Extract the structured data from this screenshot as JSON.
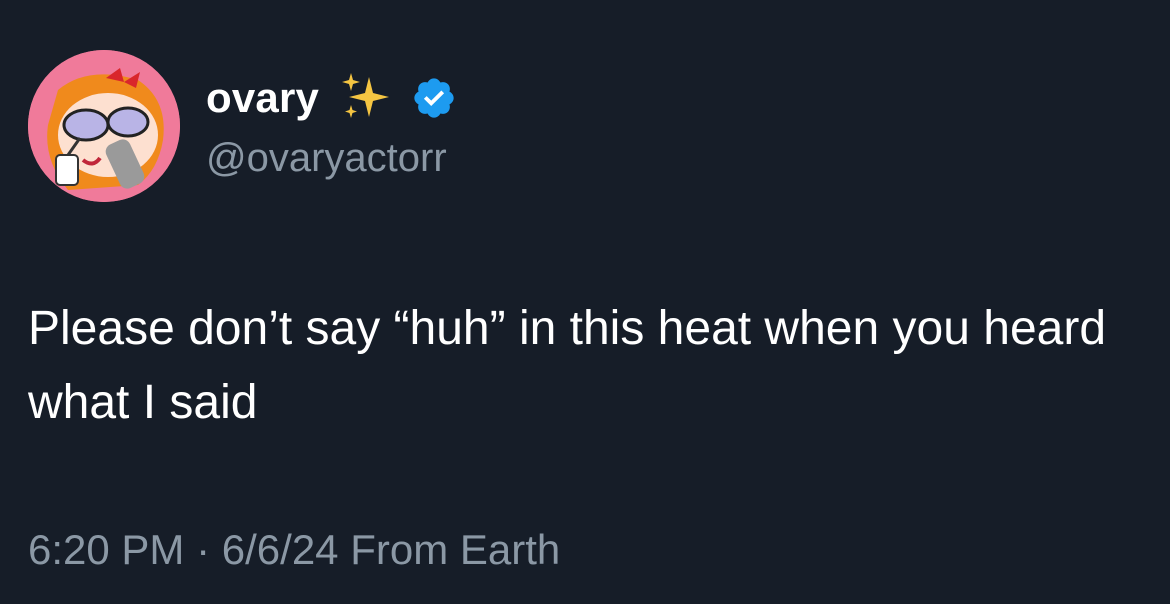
{
  "author": {
    "display_name": "ovary",
    "handle": "@ovaryactorr",
    "verified": true,
    "badge_color": "#1d9bf0",
    "sparkle_color": "#f5c542"
  },
  "tweet": {
    "text": "Please don’t say “huh” in this heat when you heard what I said"
  },
  "meta": {
    "time": "6:20 PM",
    "separator": "·",
    "date": "6/6/24",
    "source": "From Earth",
    "full": "6:20 PM · 6/6/24 From Earth"
  },
  "theme": {
    "background": "#161d28",
    "primary_text": "#ffffff",
    "secondary_text": "#8b98a5",
    "avatar_background": "#f07a9a"
  }
}
